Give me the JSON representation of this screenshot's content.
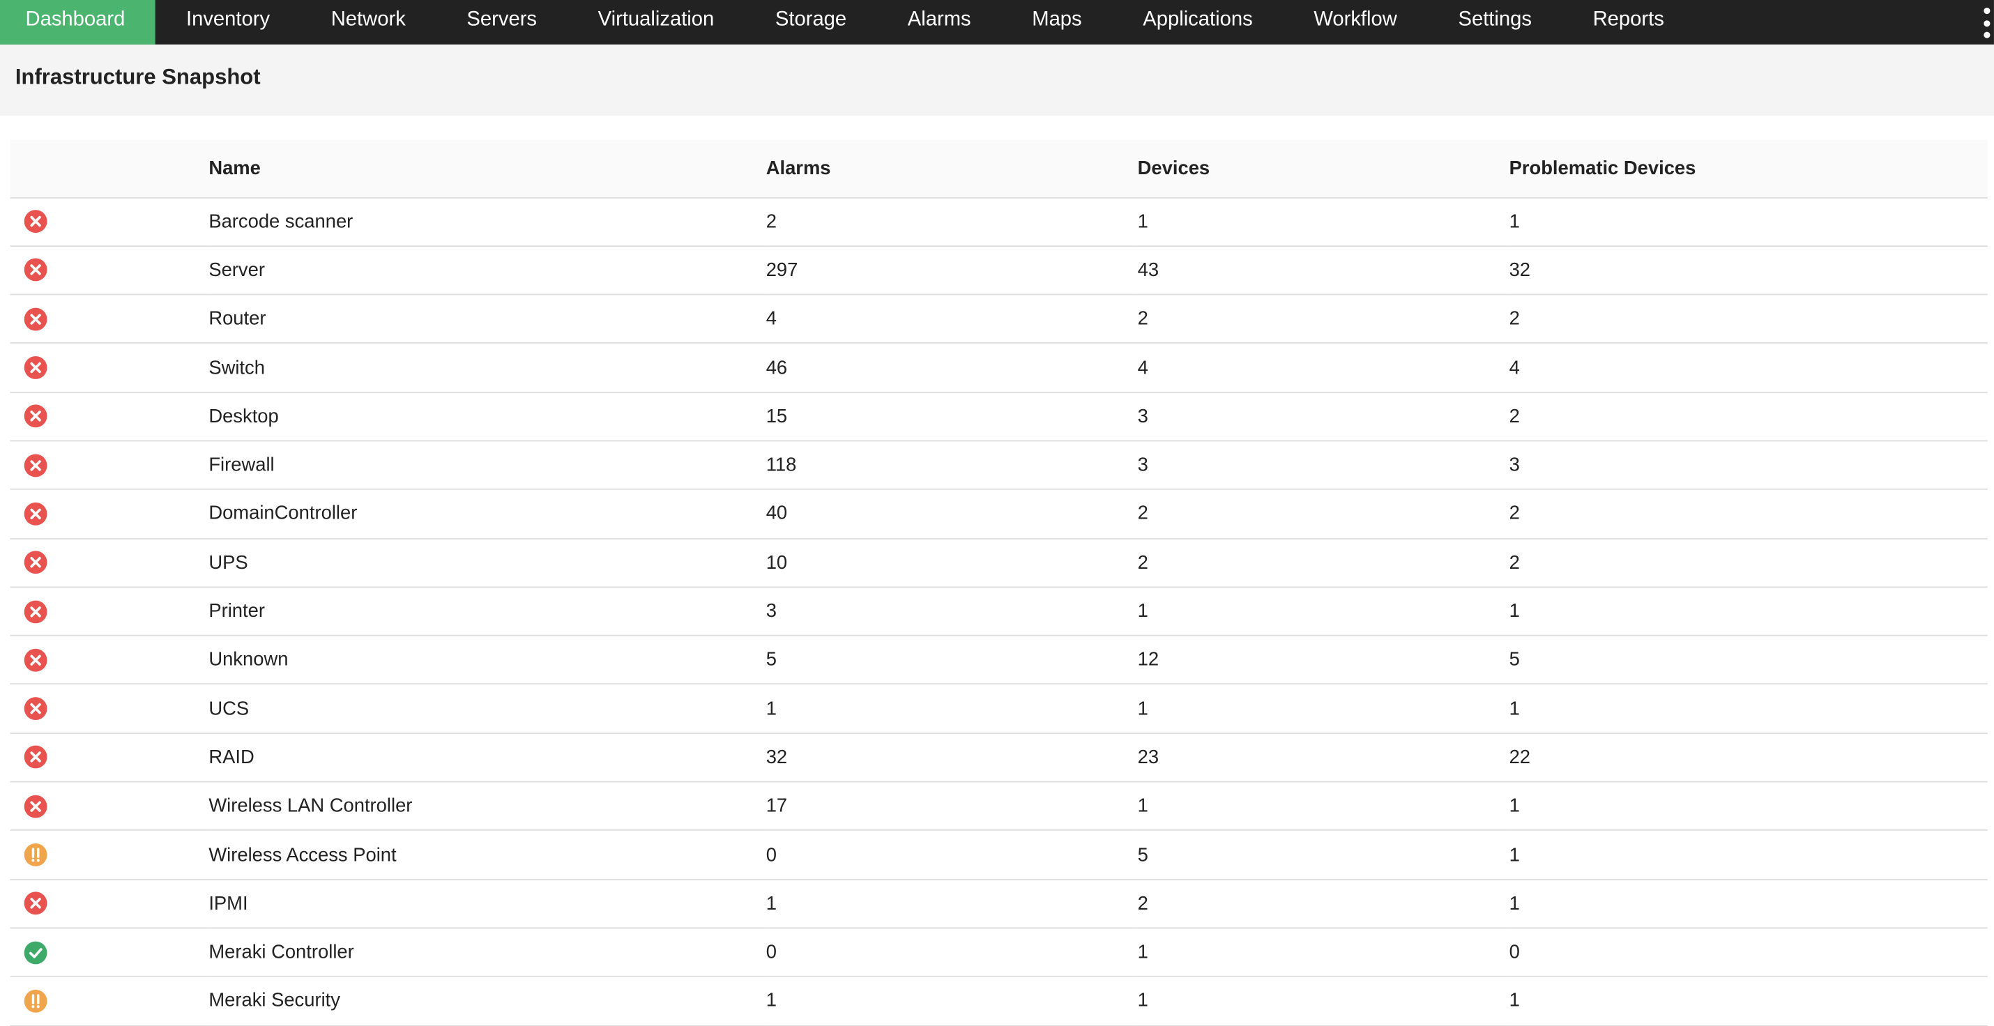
{
  "nav": {
    "items": [
      {
        "label": "Dashboard",
        "active": true
      },
      {
        "label": "Inventory",
        "active": false
      },
      {
        "label": "Network",
        "active": false
      },
      {
        "label": "Servers",
        "active": false
      },
      {
        "label": "Virtualization",
        "active": false
      },
      {
        "label": "Storage",
        "active": false
      },
      {
        "label": "Alarms",
        "active": false
      },
      {
        "label": "Maps",
        "active": false
      },
      {
        "label": "Applications",
        "active": false
      },
      {
        "label": "Workflow",
        "active": false
      },
      {
        "label": "Settings",
        "active": false
      },
      {
        "label": "Reports",
        "active": false
      }
    ],
    "more_icon": "vertical-ellipsis-icon",
    "active_color": "#4bb56f",
    "bar_color": "#222222"
  },
  "page": {
    "title": "Infrastructure Snapshot"
  },
  "table": {
    "columns": [
      "",
      "Name",
      "Alarms",
      "Devices",
      "Problematic Devices"
    ],
    "status_colors": {
      "critical": "#e8534f",
      "warning": "#f0a44b",
      "ok": "#3daa6a"
    },
    "rows": [
      {
        "status": "critical",
        "name": "Barcode scanner",
        "alarms": "2",
        "devices": "1",
        "problematic": "1"
      },
      {
        "status": "critical",
        "name": "Server",
        "alarms": "297",
        "devices": "43",
        "problematic": "32"
      },
      {
        "status": "critical",
        "name": "Router",
        "alarms": "4",
        "devices": "2",
        "problematic": "2"
      },
      {
        "status": "critical",
        "name": "Switch",
        "alarms": "46",
        "devices": "4",
        "problematic": "4"
      },
      {
        "status": "critical",
        "name": "Desktop",
        "alarms": "15",
        "devices": "3",
        "problematic": "2"
      },
      {
        "status": "critical",
        "name": "Firewall",
        "alarms": "118",
        "devices": "3",
        "problematic": "3"
      },
      {
        "status": "critical",
        "name": "DomainController",
        "alarms": "40",
        "devices": "2",
        "problematic": "2"
      },
      {
        "status": "critical",
        "name": "UPS",
        "alarms": "10",
        "devices": "2",
        "problematic": "2"
      },
      {
        "status": "critical",
        "name": "Printer",
        "alarms": "3",
        "devices": "1",
        "problematic": "1"
      },
      {
        "status": "critical",
        "name": "Unknown",
        "alarms": "5",
        "devices": "12",
        "problematic": "5"
      },
      {
        "status": "critical",
        "name": "UCS",
        "alarms": "1",
        "devices": "1",
        "problematic": "1"
      },
      {
        "status": "critical",
        "name": "RAID",
        "alarms": "32",
        "devices": "23",
        "problematic": "22"
      },
      {
        "status": "critical",
        "name": "Wireless LAN Controller",
        "alarms": "17",
        "devices": "1",
        "problematic": "1"
      },
      {
        "status": "warning",
        "name": "Wireless Access Point",
        "alarms": "0",
        "devices": "5",
        "problematic": "1"
      },
      {
        "status": "critical",
        "name": "IPMI",
        "alarms": "1",
        "devices": "2",
        "problematic": "1"
      },
      {
        "status": "ok",
        "name": "Meraki Controller",
        "alarms": "0",
        "devices": "1",
        "problematic": "0"
      },
      {
        "status": "warning",
        "name": "Meraki Security",
        "alarms": "1",
        "devices": "1",
        "problematic": "1"
      }
    ]
  }
}
